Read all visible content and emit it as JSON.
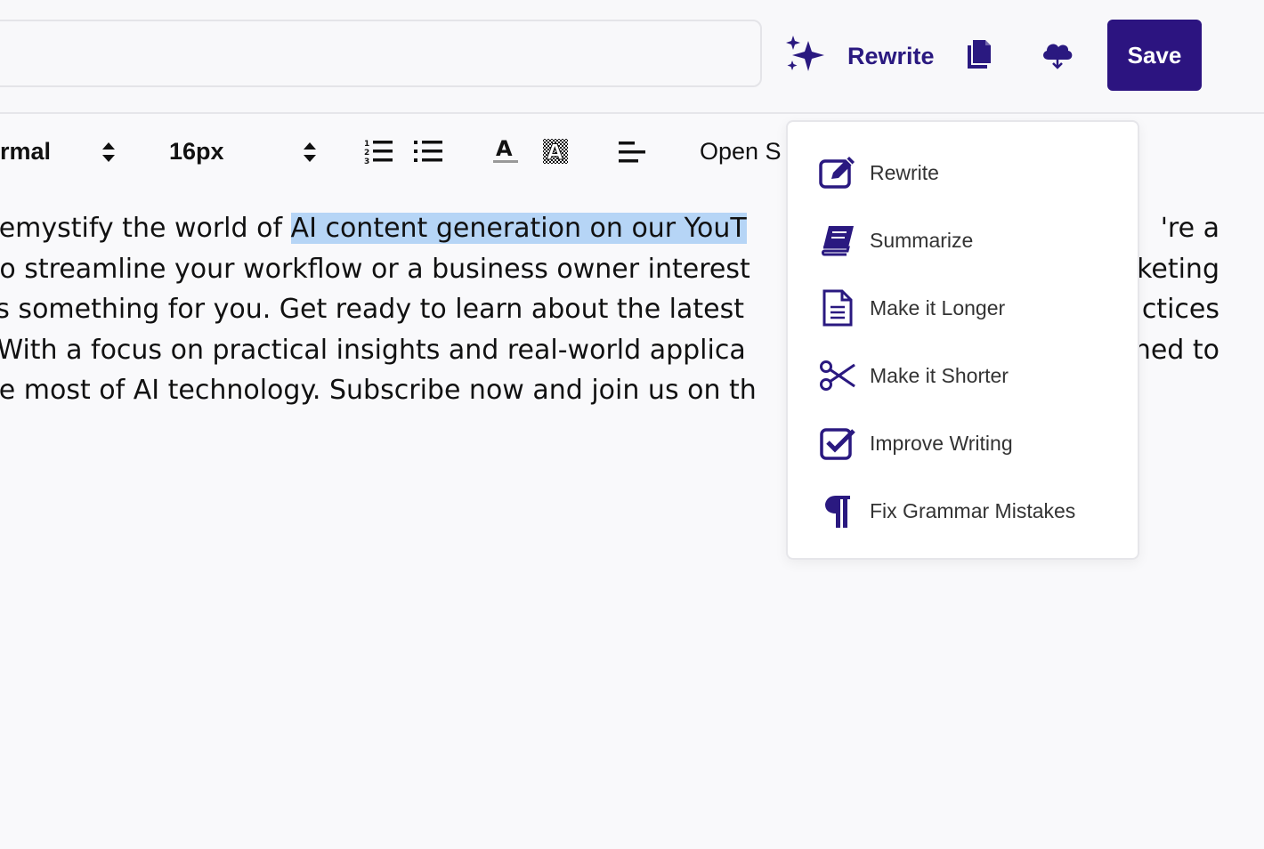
{
  "header": {
    "ai_button_label": "Rewrite",
    "save_label": "Save",
    "accent_color": "#2c1480"
  },
  "toolbar": {
    "block_style": "rmal",
    "font_size": "16px",
    "font_family": "Open S"
  },
  "editor": {
    "lines": [
      {
        "before": "to demystify the world of ",
        "highlight": "AI content generation on our YouT",
        "after": ""
      },
      {
        "before": "ng to streamline your workflow or a business owner interest",
        "highlight": "",
        "after": ""
      },
      {
        "before": "l has something for you. Get ready to learn about the latest",
        "highlight": "",
        "after": ""
      },
      {
        "before": "on. With a focus on practical insights and real-world applica",
        "highlight": "",
        "after": ""
      },
      {
        "before": "e the most of AI technology. Subscribe now and join us on th",
        "highlight": "",
        "after": ""
      }
    ],
    "right_fragments": [
      "'re a",
      "keting",
      "ctices",
      "ned to"
    ]
  },
  "menu": {
    "items": [
      {
        "label": "Rewrite",
        "icon": "pencil-square-icon"
      },
      {
        "label": "Summarize",
        "icon": "book-icon"
      },
      {
        "label": "Make it Longer",
        "icon": "document-lines-icon"
      },
      {
        "label": "Make it Shorter",
        "icon": "scissors-icon"
      },
      {
        "label": "Improve Writing",
        "icon": "check-square-icon"
      },
      {
        "label": "Fix Grammar Mistakes",
        "icon": "pilcrow-icon"
      }
    ]
  }
}
